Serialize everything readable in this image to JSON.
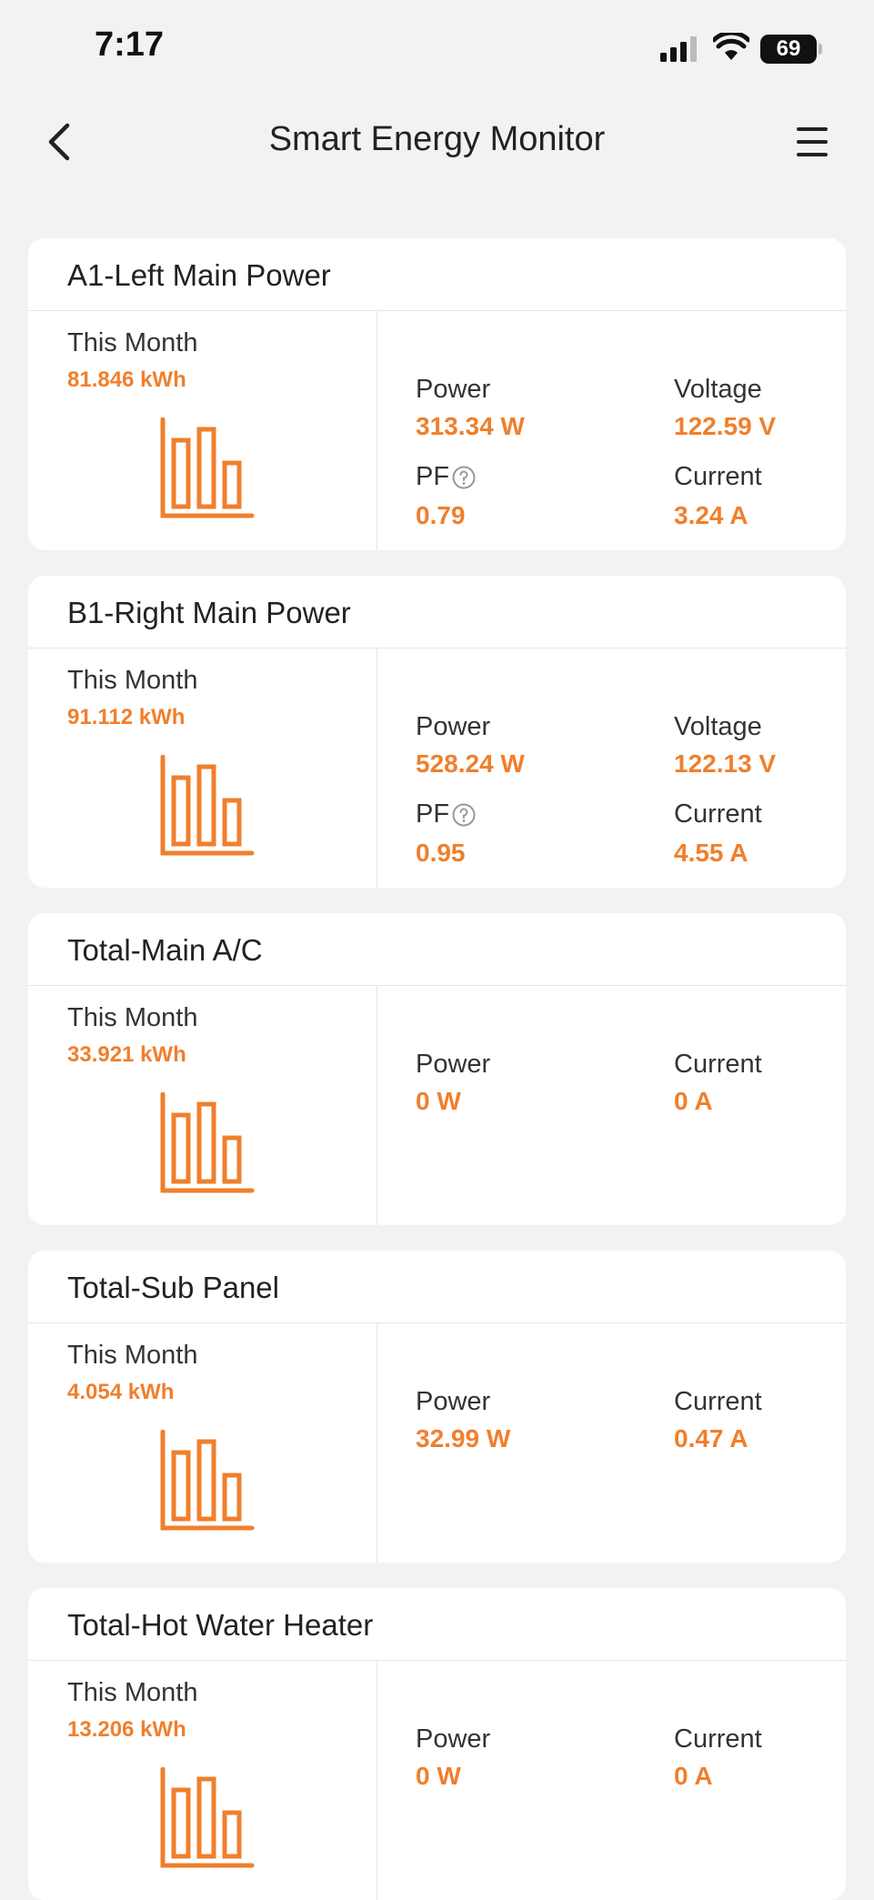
{
  "status": {
    "time": "7:17",
    "battery": "69"
  },
  "header": {
    "title": "Smart Energy Monitor"
  },
  "colors": {
    "accent": "#f07f2c",
    "background": "#f2f2f2",
    "card": "#ffffff"
  },
  "cards": [
    {
      "title": "A1-Left Main Power",
      "month_label": "This Month",
      "month_value": "81.846 kWh",
      "power_label": "Power",
      "power_value": "313.34 W",
      "voltage_label": "Voltage",
      "voltage_value": "122.59 V",
      "pf_label": "PF",
      "pf_value": "0.79",
      "current_label": "Current",
      "current_value": "3.24 A"
    },
    {
      "title": "B1-Right Main Power",
      "month_label": "This Month",
      "month_value": "91.112 kWh",
      "power_label": "Power",
      "power_value": "528.24 W",
      "voltage_label": "Voltage",
      "voltage_value": "122.13 V",
      "pf_label": "PF",
      "pf_value": "0.95",
      "current_label": "Current",
      "current_value": "4.55 A"
    },
    {
      "title": "Total-Main A/C",
      "month_label": "This Month",
      "month_value": "33.921 kWh",
      "power_label": "Power",
      "power_value": "0 W",
      "current_label": "Current",
      "current_value": "0 A"
    },
    {
      "title": "Total-Sub Panel",
      "month_label": "This Month",
      "month_value": "4.054 kWh",
      "power_label": "Power",
      "power_value": "32.99 W",
      "current_label": "Current",
      "current_value": "0.47 A"
    },
    {
      "title": "Total-Hot Water Heater",
      "month_label": "This Month",
      "month_value": "13.206 kWh",
      "power_label": "Power",
      "power_value": "0 W",
      "current_label": "Current",
      "current_value": "0 A"
    }
  ]
}
